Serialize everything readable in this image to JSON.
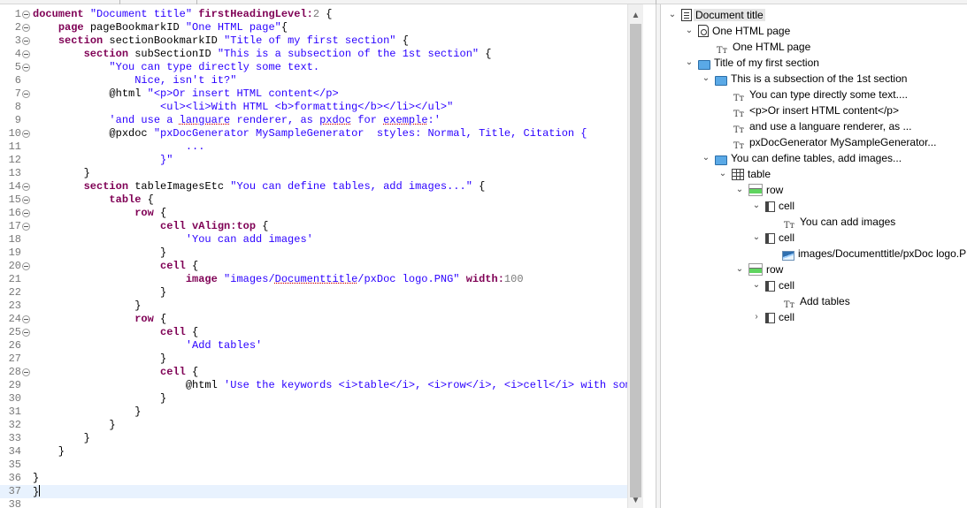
{
  "editor": {
    "lines": [
      {
        "n": "1",
        "fold": true,
        "tokens": [
          {
            "t": "k",
            "v": "document"
          },
          {
            "t": "p",
            "v": " "
          },
          {
            "t": "s",
            "v": "\"Document title\""
          },
          {
            "t": "p",
            "v": " "
          },
          {
            "t": "k",
            "v": "firstHeadingLevel:"
          },
          {
            "t": "n",
            "v": "2"
          },
          {
            "t": "p",
            "v": " {"
          }
        ]
      },
      {
        "n": "2",
        "fold": true,
        "tokens": [
          {
            "t": "p",
            "v": "    "
          },
          {
            "t": "k",
            "v": "page"
          },
          {
            "t": "p",
            "v": " pageBookmarkID "
          },
          {
            "t": "s",
            "v": "\"One HTML page\""
          },
          {
            "t": "p",
            "v": "{"
          }
        ]
      },
      {
        "n": "3",
        "fold": true,
        "tokens": [
          {
            "t": "p",
            "v": "    "
          },
          {
            "t": "k",
            "v": "section"
          },
          {
            "t": "p",
            "v": " sectionBookmarkID "
          },
          {
            "t": "s",
            "v": "\"Title of my first section\""
          },
          {
            "t": "p",
            "v": " {"
          }
        ]
      },
      {
        "n": "4",
        "fold": true,
        "tokens": [
          {
            "t": "p",
            "v": "        "
          },
          {
            "t": "k",
            "v": "section"
          },
          {
            "t": "p",
            "v": " subSectionID "
          },
          {
            "t": "s",
            "v": "\"This is a subsection of the 1st section\""
          },
          {
            "t": "p",
            "v": " {"
          }
        ]
      },
      {
        "n": "5",
        "fold": true,
        "tokens": [
          {
            "t": "s",
            "v": "            \"You can type directly some text."
          }
        ]
      },
      {
        "n": "6",
        "fold": false,
        "tokens": [
          {
            "t": "s",
            "v": "                Nice, isn't it?\""
          }
        ]
      },
      {
        "n": "7",
        "fold": true,
        "tokens": [
          {
            "t": "p",
            "v": "            @html "
          },
          {
            "t": "s",
            "v": "\"<p>Or insert HTML content</p>"
          }
        ]
      },
      {
        "n": "8",
        "fold": false,
        "tokens": [
          {
            "t": "s",
            "v": "                    <ul><li>With HTML <b>formatting</b></li></ul>\""
          }
        ]
      },
      {
        "n": "9",
        "fold": false,
        "tokens": [
          {
            "t": "s",
            "v": "            'and use a "
          },
          {
            "t": "sx",
            "v": "languare"
          },
          {
            "t": "s",
            "v": " renderer, as "
          },
          {
            "t": "sx",
            "v": "pxdoc"
          },
          {
            "t": "s",
            "v": " for "
          },
          {
            "t": "sx",
            "v": "exemple"
          },
          {
            "t": "s",
            "v": ":'"
          }
        ]
      },
      {
        "n": "10",
        "fold": true,
        "tokens": [
          {
            "t": "p",
            "v": "            @pxdoc "
          },
          {
            "t": "s",
            "v": "\"pxDocGenerator MySampleGenerator  styles: Normal, Title, Citation {"
          }
        ]
      },
      {
        "n": "11",
        "fold": false,
        "tokens": [
          {
            "t": "s",
            "v": "                        ..."
          }
        ]
      },
      {
        "n": "12",
        "fold": false,
        "tokens": [
          {
            "t": "s",
            "v": "                    }\""
          }
        ]
      },
      {
        "n": "13",
        "fold": false,
        "tokens": [
          {
            "t": "p",
            "v": "        }"
          }
        ]
      },
      {
        "n": "14",
        "fold": true,
        "tokens": [
          {
            "t": "p",
            "v": "        "
          },
          {
            "t": "k",
            "v": "section"
          },
          {
            "t": "p",
            "v": " tableImagesEtc "
          },
          {
            "t": "s",
            "v": "\"You can define tables, add images...\""
          },
          {
            "t": "p",
            "v": " {"
          }
        ]
      },
      {
        "n": "15",
        "fold": true,
        "tokens": [
          {
            "t": "p",
            "v": "            "
          },
          {
            "t": "k",
            "v": "table"
          },
          {
            "t": "p",
            "v": " {"
          }
        ]
      },
      {
        "n": "16",
        "fold": true,
        "tokens": [
          {
            "t": "p",
            "v": "                "
          },
          {
            "t": "k",
            "v": "row"
          },
          {
            "t": "p",
            "v": " {"
          }
        ]
      },
      {
        "n": "17",
        "fold": true,
        "tokens": [
          {
            "t": "p",
            "v": "                    "
          },
          {
            "t": "k",
            "v": "cell"
          },
          {
            "t": "p",
            "v": " "
          },
          {
            "t": "k",
            "v": "vAlign:top"
          },
          {
            "t": "p",
            "v": " {"
          }
        ]
      },
      {
        "n": "18",
        "fold": false,
        "tokens": [
          {
            "t": "s",
            "v": "                        'You can add images'"
          }
        ]
      },
      {
        "n": "19",
        "fold": false,
        "tokens": [
          {
            "t": "p",
            "v": "                    }"
          }
        ]
      },
      {
        "n": "20",
        "fold": true,
        "tokens": [
          {
            "t": "p",
            "v": "                    "
          },
          {
            "t": "k",
            "v": "cell"
          },
          {
            "t": "p",
            "v": " {"
          }
        ]
      },
      {
        "n": "21",
        "fold": false,
        "tokens": [
          {
            "t": "p",
            "v": "                        "
          },
          {
            "t": "k",
            "v": "image"
          },
          {
            "t": "p",
            "v": " "
          },
          {
            "t": "s",
            "v": "\"images/"
          },
          {
            "t": "sx",
            "v": "Documenttitle"
          },
          {
            "t": "s",
            "v": "/pxDoc logo.PNG\""
          },
          {
            "t": "p",
            "v": " "
          },
          {
            "t": "k",
            "v": "width:"
          },
          {
            "t": "n",
            "v": "100"
          }
        ]
      },
      {
        "n": "22",
        "fold": false,
        "tokens": [
          {
            "t": "p",
            "v": "                    }"
          }
        ]
      },
      {
        "n": "23",
        "fold": false,
        "tokens": [
          {
            "t": "p",
            "v": "                }"
          }
        ]
      },
      {
        "n": "24",
        "fold": true,
        "tokens": [
          {
            "t": "p",
            "v": "                "
          },
          {
            "t": "k",
            "v": "row"
          },
          {
            "t": "p",
            "v": " {"
          }
        ]
      },
      {
        "n": "25",
        "fold": true,
        "tokens": [
          {
            "t": "p",
            "v": "                    "
          },
          {
            "t": "k",
            "v": "cell"
          },
          {
            "t": "p",
            "v": " {"
          }
        ]
      },
      {
        "n": "26",
        "fold": false,
        "tokens": [
          {
            "t": "s",
            "v": "                        'Add tables'"
          }
        ]
      },
      {
        "n": "27",
        "fold": false,
        "tokens": [
          {
            "t": "p",
            "v": "                    }"
          }
        ]
      },
      {
        "n": "28",
        "fold": true,
        "tokens": [
          {
            "t": "p",
            "v": "                    "
          },
          {
            "t": "k",
            "v": "cell"
          },
          {
            "t": "p",
            "v": " {"
          }
        ]
      },
      {
        "n": "29",
        "fold": false,
        "tokens": [
          {
            "t": "p",
            "v": "                        @html "
          },
          {
            "t": "s",
            "v": "'Use the keywords <i>table</i>, <i>row</i>, <i>cell</i> with some"
          }
        ]
      },
      {
        "n": "30",
        "fold": false,
        "tokens": [
          {
            "t": "p",
            "v": "                    }"
          }
        ]
      },
      {
        "n": "31",
        "fold": false,
        "tokens": [
          {
            "t": "p",
            "v": "                }"
          }
        ]
      },
      {
        "n": "32",
        "fold": false,
        "tokens": [
          {
            "t": "p",
            "v": "            }"
          }
        ]
      },
      {
        "n": "33",
        "fold": false,
        "tokens": [
          {
            "t": "p",
            "v": "        }"
          }
        ]
      },
      {
        "n": "34",
        "fold": false,
        "tokens": [
          {
            "t": "p",
            "v": "    }"
          }
        ]
      },
      {
        "n": "35",
        "fold": false,
        "tokens": []
      },
      {
        "n": "36",
        "fold": false,
        "tokens": [
          {
            "t": "p",
            "v": "}"
          }
        ]
      },
      {
        "n": "37",
        "fold": false,
        "current": true,
        "tokens": [
          {
            "t": "p",
            "v": "}"
          }
        ]
      },
      {
        "n": "38",
        "fold": false,
        "tokens": []
      }
    ],
    "scroll_up_glyph": "▲",
    "scroll_down_glyph": "▼"
  },
  "outline": {
    "items": [
      {
        "name": "outline-document-title",
        "depth": 0,
        "twisty": "⌄",
        "icon": "doc",
        "label": "Document title",
        "selected": true
      },
      {
        "name": "outline-page",
        "depth": 1,
        "twisty": "⌄",
        "icon": "page",
        "label": "One HTML page"
      },
      {
        "name": "outline-text",
        "depth": 2,
        "twisty": "",
        "icon": "text",
        "label": "One HTML page"
      },
      {
        "name": "outline-section",
        "depth": 1,
        "twisty": "⌄",
        "icon": "folder",
        "label": "Title of my first section"
      },
      {
        "name": "outline-section",
        "depth": 2,
        "twisty": "⌄",
        "icon": "folder",
        "label": "This is a subsection of the 1st section"
      },
      {
        "name": "outline-text",
        "depth": 3,
        "twisty": "",
        "icon": "text",
        "label": "You can type directly some text...."
      },
      {
        "name": "outline-text",
        "depth": 3,
        "twisty": "",
        "icon": "text",
        "label": "<p>Or insert HTML content</p>"
      },
      {
        "name": "outline-text",
        "depth": 3,
        "twisty": "",
        "icon": "text",
        "label": "and use a languare renderer, as ..."
      },
      {
        "name": "outline-text",
        "depth": 3,
        "twisty": "",
        "icon": "text",
        "label": "pxDocGenerator MySampleGenerator..."
      },
      {
        "name": "outline-section",
        "depth": 2,
        "twisty": "⌄",
        "icon": "folder",
        "label": "You can define tables, add images..."
      },
      {
        "name": "outline-table",
        "depth": 3,
        "twisty": "⌄",
        "icon": "table",
        "label": "table"
      },
      {
        "name": "outline-row",
        "depth": 4,
        "twisty": "⌄",
        "icon": "row",
        "label": "row"
      },
      {
        "name": "outline-cell",
        "depth": 5,
        "twisty": "⌄",
        "icon": "cell",
        "label": "cell"
      },
      {
        "name": "outline-text",
        "depth": 6,
        "twisty": "",
        "icon": "text",
        "label": "You can add images"
      },
      {
        "name": "outline-cell",
        "depth": 5,
        "twisty": "⌄",
        "icon": "cell",
        "label": "cell"
      },
      {
        "name": "outline-image",
        "depth": 6,
        "twisty": "",
        "icon": "image",
        "label": "images/Documenttitle/pxDoc logo.PNG"
      },
      {
        "name": "outline-row",
        "depth": 4,
        "twisty": "⌄",
        "icon": "row",
        "label": "row"
      },
      {
        "name": "outline-cell",
        "depth": 5,
        "twisty": "⌄",
        "icon": "cell",
        "label": "cell"
      },
      {
        "name": "outline-text",
        "depth": 6,
        "twisty": "",
        "icon": "text",
        "label": "Add tables"
      },
      {
        "name": "outline-cell",
        "depth": 5,
        "twisty": "›",
        "icon": "cell",
        "label": "cell"
      }
    ]
  },
  "colors": {
    "keyword": "#7f0055",
    "string": "#2a00ff",
    "number": "#7a7a7a",
    "current_line": "#e8f2fe",
    "selection": "#e5e5e5"
  }
}
